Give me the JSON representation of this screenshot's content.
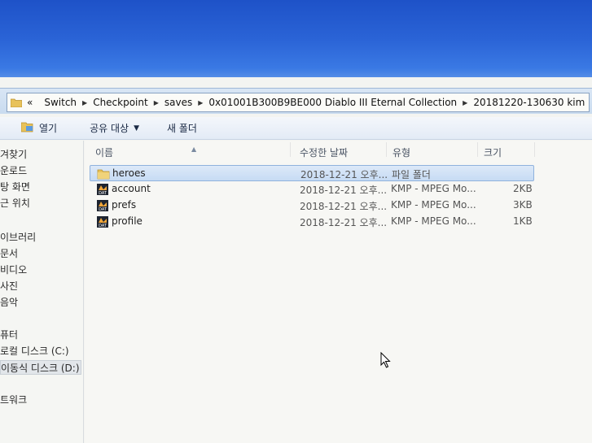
{
  "address_bar": {
    "crumbs": [
      "Switch",
      "Checkpoint",
      "saves",
      "0x01001B300B9BE000 Diablo III  Eternal Collection",
      "20181220-130630 kim"
    ],
    "prefix": "«"
  },
  "toolbar": {
    "open_label": "열기",
    "share_label": "공유 대상",
    "new_folder_label": "새 폴더"
  },
  "nav": {
    "items": [
      {
        "label": "겨찾기"
      },
      {
        "label": "운로드"
      },
      {
        "label": "탕 화면"
      },
      {
        "label": "근 위치"
      },
      {
        "label": "이브러리"
      },
      {
        "label": "문서"
      },
      {
        "label": "비디오"
      },
      {
        "label": "사진"
      },
      {
        "label": "음악"
      },
      {
        "label": "퓨터"
      },
      {
        "label": "로컬 디스크 (C:)"
      },
      {
        "label": "이동식 디스크 (D:)"
      },
      {
        "label": "트워크"
      }
    ]
  },
  "columns": {
    "name": "이름",
    "date": "수정한 날짜",
    "type": "유형",
    "size": "크기"
  },
  "files": [
    {
      "name": "heroes",
      "date": "2018-12-21 오후...",
      "type": "파일 폴더",
      "size": "",
      "icon": "folder-icon"
    },
    {
      "name": "account",
      "date": "2018-12-21 오후...",
      "type": "KMP - MPEG Mo...",
      "size": "2KB",
      "icon": "dat-file-icon"
    },
    {
      "name": "prefs",
      "date": "2018-12-21 오후...",
      "type": "KMP - MPEG Mo...",
      "size": "3KB",
      "icon": "dat-file-icon"
    },
    {
      "name": "profile",
      "date": "2018-12-21 오후...",
      "type": "KMP - MPEG Mo...",
      "size": "1KB",
      "icon": "dat-file-icon"
    }
  ],
  "colors": {
    "desktop_blue": "#2a63d6",
    "selection": "#c6dbf4",
    "folder_yellow": "#e8c25a"
  }
}
